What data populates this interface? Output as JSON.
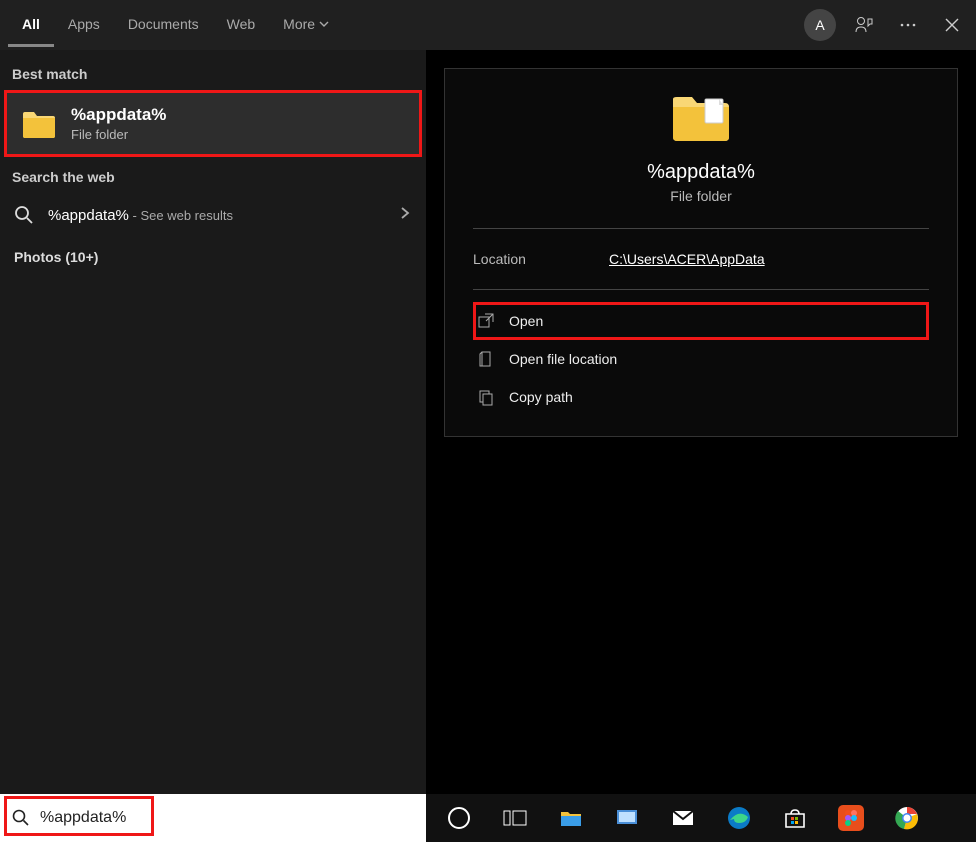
{
  "header": {
    "tabs": [
      "All",
      "Apps",
      "Documents",
      "Web",
      "More"
    ],
    "avatar": "A"
  },
  "left": {
    "best_match_label": "Best match",
    "best_match": {
      "title": "%appdata%",
      "subtitle": "File folder"
    },
    "web_label": "Search the web",
    "web_item": {
      "query": "%appdata%",
      "suffix": " - See web results"
    },
    "photos": "Photos (10+)"
  },
  "preview": {
    "title": "%appdata%",
    "subtitle": "File folder",
    "location_label": "Location",
    "location_value": "C:\\Users\\ACER\\AppData",
    "actions": [
      "Open",
      "Open file location",
      "Copy path"
    ]
  },
  "searchbox": {
    "value": "%appdata%"
  }
}
